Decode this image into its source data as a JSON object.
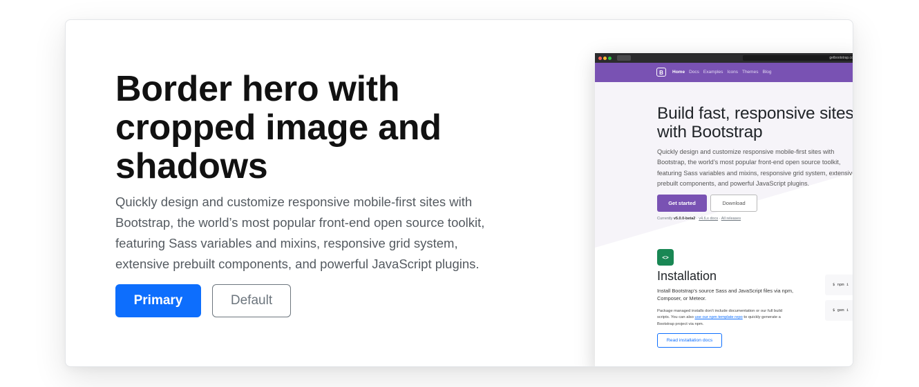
{
  "hero": {
    "title": "Border hero with cropped image and shadows",
    "lead": "Quickly design and customize responsive mobile-first sites with Bootstrap, the world’s most popular front-end open source toolkit, featuring Sass variables and mixins, responsive grid system, extensive prebuilt components, and powerful JavaScript plugins.",
    "primary_label": "Primary",
    "default_label": "Default",
    "primary_color": "#0d6efd"
  },
  "screenshot": {
    "url": "getbootstrap.com",
    "logo": "B",
    "nav": [
      "Home",
      "Docs",
      "Examples",
      "Icons",
      "Themes",
      "Blog"
    ],
    "brand_color": "#7952b3",
    "title_line1": "Build fast, responsive sites",
    "title_line2": "with Bootstrap",
    "lead": "Quickly design and customize responsive mobile-first sites with\nBootstrap, the world’s most popular front-end open source toolkit,\nfeaturing Sass variables and mixins, responsive grid system, extensive\nprebuilt components, and powerful JavaScript plugins.",
    "get_started": "Get started",
    "download": "Download",
    "version_prefix": "Currently",
    "version": "v5.0.0-beta2",
    "sep1": "·",
    "v4_docs": "v4.6.x docs",
    "sep2": "·",
    "all_releases": "All releases",
    "code_icon": "<>",
    "install_title": "Installation",
    "install_desc": "Install Bootstrap’s source Sass and JavaScript files via npm,\nComposer, or Meteor.",
    "note_line1": "Package managed installs don’t include documentation or our full build",
    "note_line2_pre": "scripts. You can also",
    "note_link": "use our npm template repo",
    "note_line2_post": "to quickly generate a",
    "note_line3": "Bootstrap project via npm.",
    "install_button": "Read installation docs",
    "code1": "$ npm i",
    "code2": "$ gem i"
  }
}
